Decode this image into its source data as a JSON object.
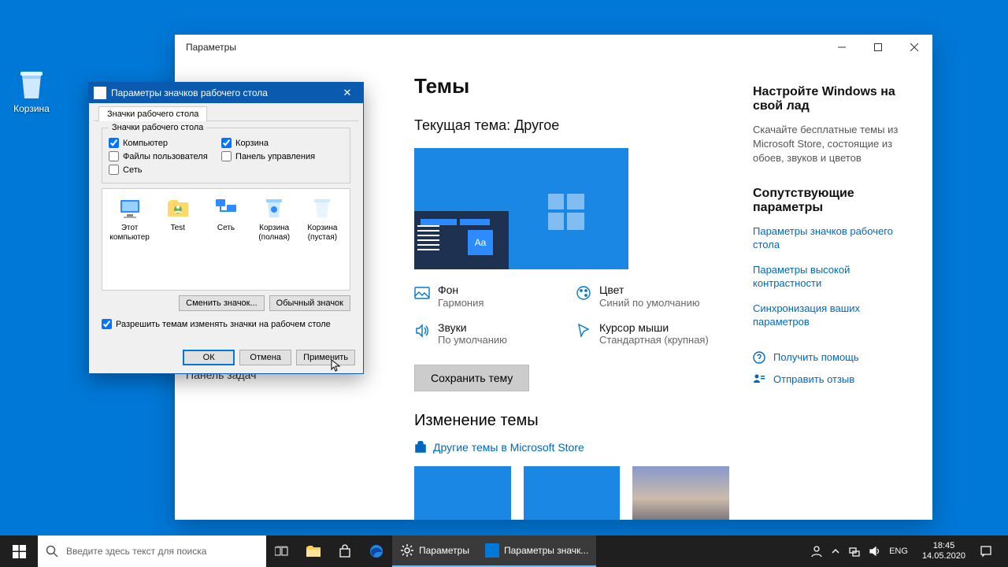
{
  "desktop": {
    "recycle_label": "Корзина"
  },
  "settingsWin": {
    "title": "Параметры",
    "main": {
      "h1": "Темы",
      "currentTheme": "Текущая тема: Другое",
      "preview_aa": "Aa",
      "props": {
        "bg_t": "Фон",
        "bg_v": "Гармония",
        "color_t": "Цвет",
        "color_v": "Синий по умолчанию",
        "sound_t": "Звуки",
        "sound_v": "По умолчанию",
        "cursor_t": "Курсор мыши",
        "cursor_v": "Стандартная (крупная)"
      },
      "save": "Сохранить тему",
      "changeHdr": "Изменение темы",
      "storeLink": "Другие темы в Microsoft Store"
    },
    "side": {
      "h1": "Настройте Windows на свой лад",
      "p1": "Скачайте бесплатные темы из Microsoft Store, состоящие из обоев, звуков и цветов",
      "h2": "Сопутствующие параметры",
      "l1": "Параметры значков рабочего стола",
      "l2": "Параметры высокой контрастности",
      "l3": "Синхронизация ваших параметров",
      "help": "Получить помощь",
      "feedback": "Отправить отзыв"
    },
    "behind_nav": "Панель задач"
  },
  "dlg": {
    "title": "Параметры значков рабочего стола",
    "tab": "Значки рабочего стола",
    "grp": "Значки рабочего стола",
    "chk_computer": "Компьютер",
    "chk_recycle": "Корзина",
    "chk_userfiles": "Файлы пользователя",
    "chk_cpanel": "Панель управления",
    "chk_network": "Сеть",
    "icons": {
      "pc": "Этот компьютер",
      "user": "Test",
      "net": "Сеть",
      "bin_full": "Корзина (полная)",
      "bin_empty": "Корзина (пустая)"
    },
    "btn_change": "Сменить значок...",
    "btn_default": "Обычный значок",
    "allow_themes": "Разрешить темам изменять значки на рабочем столе",
    "ok": "ОК",
    "cancel": "Отмена",
    "apply": "Применить"
  },
  "taskbar": {
    "search_placeholder": "Введите здесь текст для поиска",
    "task1": "Параметры",
    "task2": "Параметры значк...",
    "lang": "ENG",
    "time": "18:45",
    "date": "14.05.2020"
  }
}
